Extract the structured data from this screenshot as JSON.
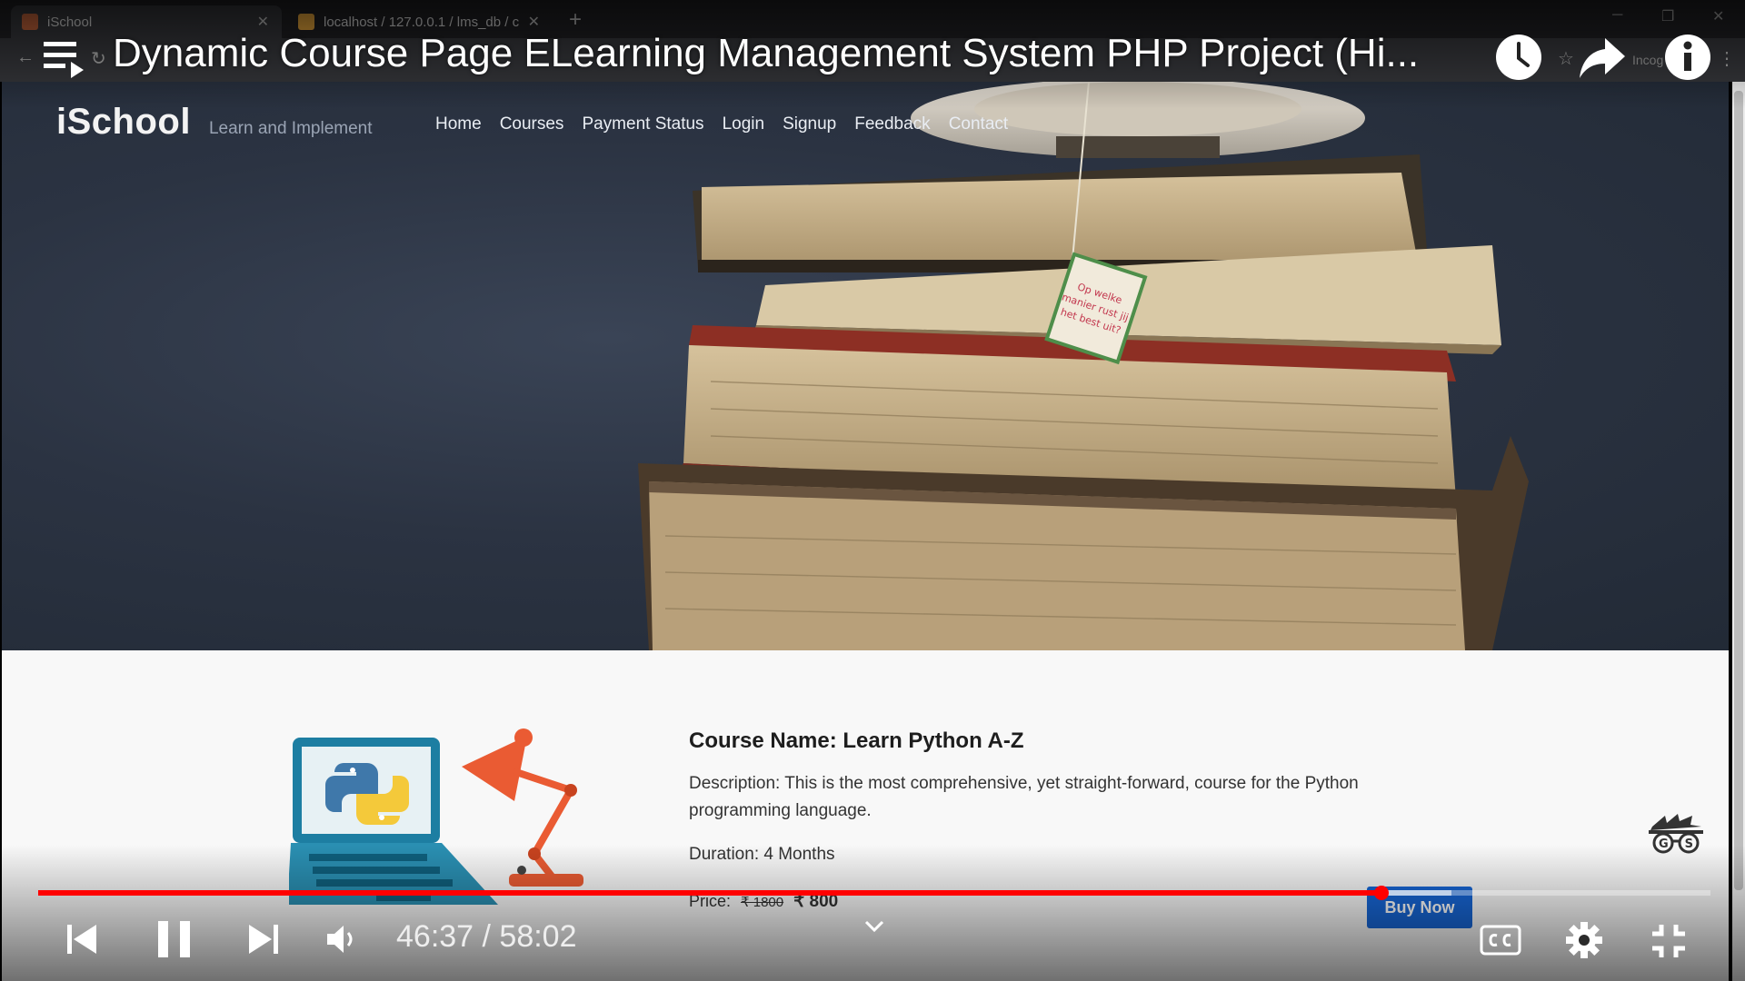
{
  "browser": {
    "tabs": [
      {
        "label": "iSchool",
        "active": true
      },
      {
        "label": "localhost / 127.0.0.1 / lms_db / c",
        "active": false
      }
    ],
    "new_tab_icon": "plus-icon",
    "incognito_label": "Incog"
  },
  "video": {
    "title": "Dynamic Course Page ELearning Management System PHP Project (Hi...",
    "current_time": "46:37",
    "duration": "58:02",
    "time_display": "46:37 / 58:02",
    "played_fraction": 0.8035,
    "buffered_fraction": 0.845,
    "accent_color": "#ff0000",
    "icons": {
      "playlist": "playlist-icon",
      "watch_later": "clock-icon",
      "share": "share-icon",
      "info": "info-icon",
      "previous": "skip-previous-icon",
      "pause": "pause-icon",
      "next": "skip-next-icon",
      "volume": "volume-icon",
      "chapters": "chevron-down-icon",
      "captions": "cc-icon",
      "settings": "gear-icon",
      "exit_fullscreen": "exit-fullscreen-icon"
    }
  },
  "site": {
    "brand": "iSchool",
    "tagline": "Learn and Implement",
    "nav": [
      "Home",
      "Courses",
      "Payment Status",
      "Login",
      "Signup",
      "Feedback",
      "Contact"
    ],
    "tea_tag_text": [
      "Op welke",
      "manier rust jij",
      "het best uit?"
    ]
  },
  "course": {
    "name": "Course Name: Learn Python A-Z",
    "description": "Description: This is the most comprehensive, yet straight-forward, course for the Python programming language.",
    "duration": "Duration: 4 Months",
    "price_label": "Price:",
    "original_price": "₹ 1800",
    "sale_price": "₹ 800",
    "buy_label": "Buy Now",
    "buy_color": "#1766d6"
  },
  "watermark": {
    "letters": "G S"
  }
}
